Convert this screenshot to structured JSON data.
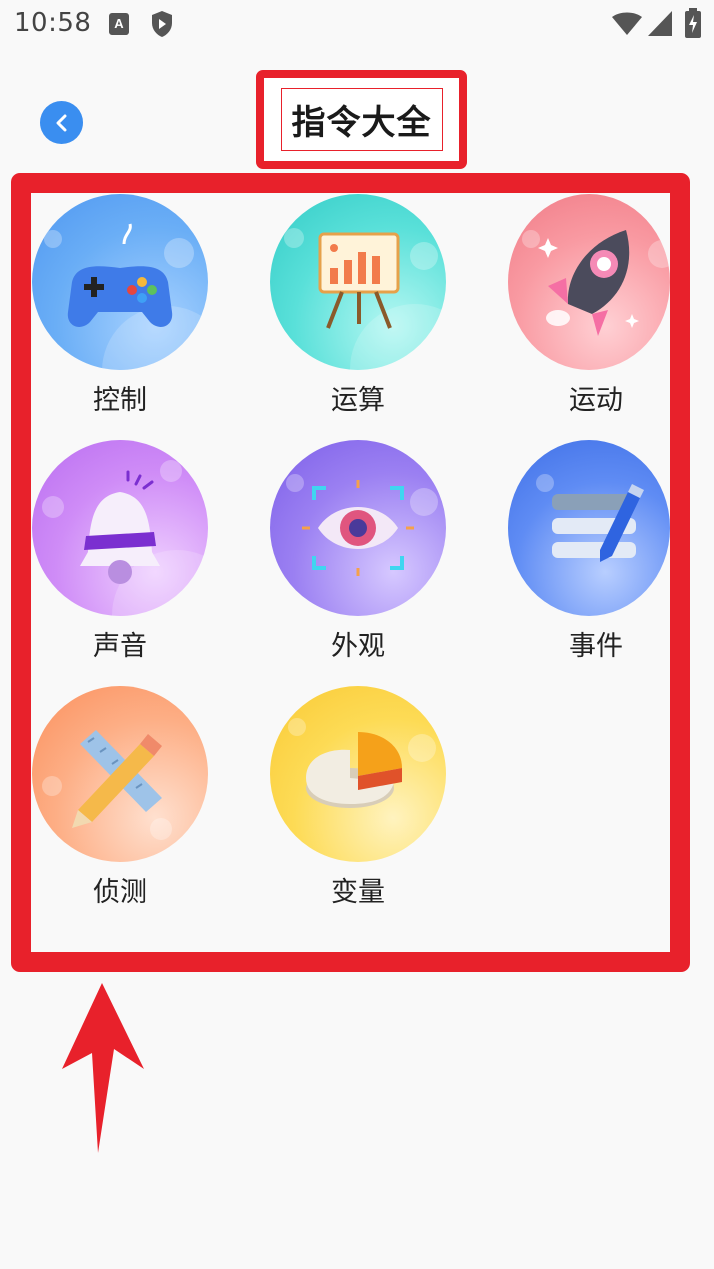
{
  "status_bar": {
    "time": "10:58",
    "icons": [
      "a-notification-icon",
      "shield-icon",
      "wifi-icon",
      "signal-icon",
      "battery-charging-icon"
    ]
  },
  "header": {
    "title": "指令大全",
    "back_icon": "chevron-left-icon"
  },
  "categories": [
    {
      "label": "控制",
      "icon": "gamepad-icon",
      "colors": [
        "#5aa8f5",
        "#9ccbff"
      ]
    },
    {
      "label": "运算",
      "icon": "chart-easel-icon",
      "colors": [
        "#3fd6d0",
        "#9ef2ec"
      ]
    },
    {
      "label": "运动",
      "icon": "rocket-icon",
      "colors": [
        "#f58a94",
        "#ffc6cb"
      ]
    },
    {
      "label": "声音",
      "icon": "bell-icon",
      "colors": [
        "#c37df5",
        "#e6c0ff"
      ]
    },
    {
      "label": "外观",
      "icon": "eye-icon",
      "colors": [
        "#8a6cf0",
        "#c3b2ff"
      ]
    },
    {
      "label": "事件",
      "icon": "list-pen-icon",
      "colors": [
        "#4a7ff2",
        "#a9c4ff"
      ]
    },
    {
      "label": "侦测",
      "icon": "pencil-ruler-icon",
      "colors": [
        "#fb9a6b",
        "#ffd2b8"
      ]
    },
    {
      "label": "变量",
      "icon": "pie-chart-icon",
      "colors": [
        "#fcd23e",
        "#ffeea8"
      ]
    }
  ],
  "accent_colors": {
    "highlight_red": "#e8212b",
    "back_button_blue": "#3a8ef0"
  }
}
